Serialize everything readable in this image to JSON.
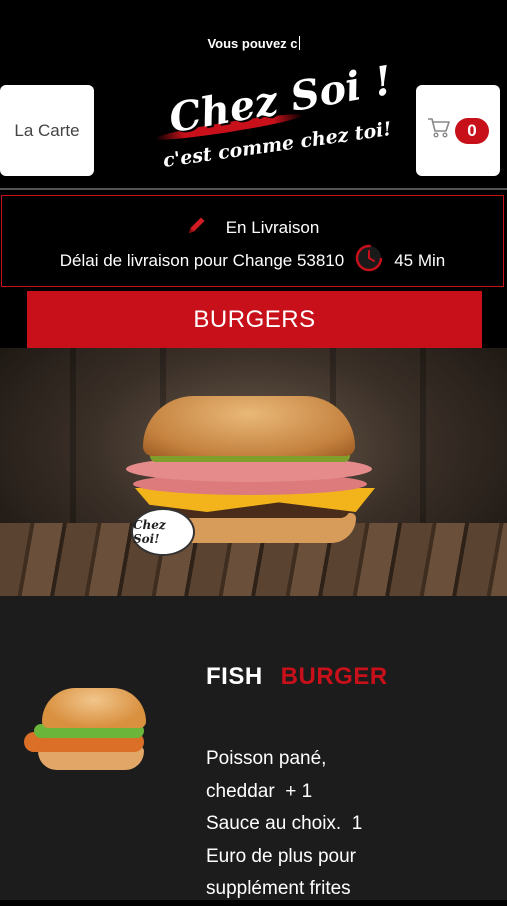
{
  "header": {
    "marquee_text": "Vous pouvez c",
    "menu_button_label": "La Carte",
    "cart_count": "0",
    "logo_line1": "Chez Soi !",
    "logo_line2": "c'est comme chez toi!"
  },
  "delivery": {
    "mode_label": "En Livraison",
    "delay_text": "Délai de livraison pour Change 53810",
    "delay_time": "45 Min"
  },
  "category": {
    "title": "BURGERS",
    "hero_badge_text": "Chez Soi!"
  },
  "product": {
    "name_word1": "FISH",
    "name_word2": "BURGER",
    "description_lines": [
      "Poisson pané,",
      "cheddar  + 1",
      "Sauce au choix.  1",
      "Euro de plus pour",
      "supplément frites"
    ]
  },
  "colors": {
    "accent": "#c8101a",
    "background": "#000000",
    "product_background": "#1c1c1c"
  },
  "icons": {
    "cart": "shopping-cart-icon",
    "pencil": "pencil-icon",
    "clock": "clock-icon"
  }
}
